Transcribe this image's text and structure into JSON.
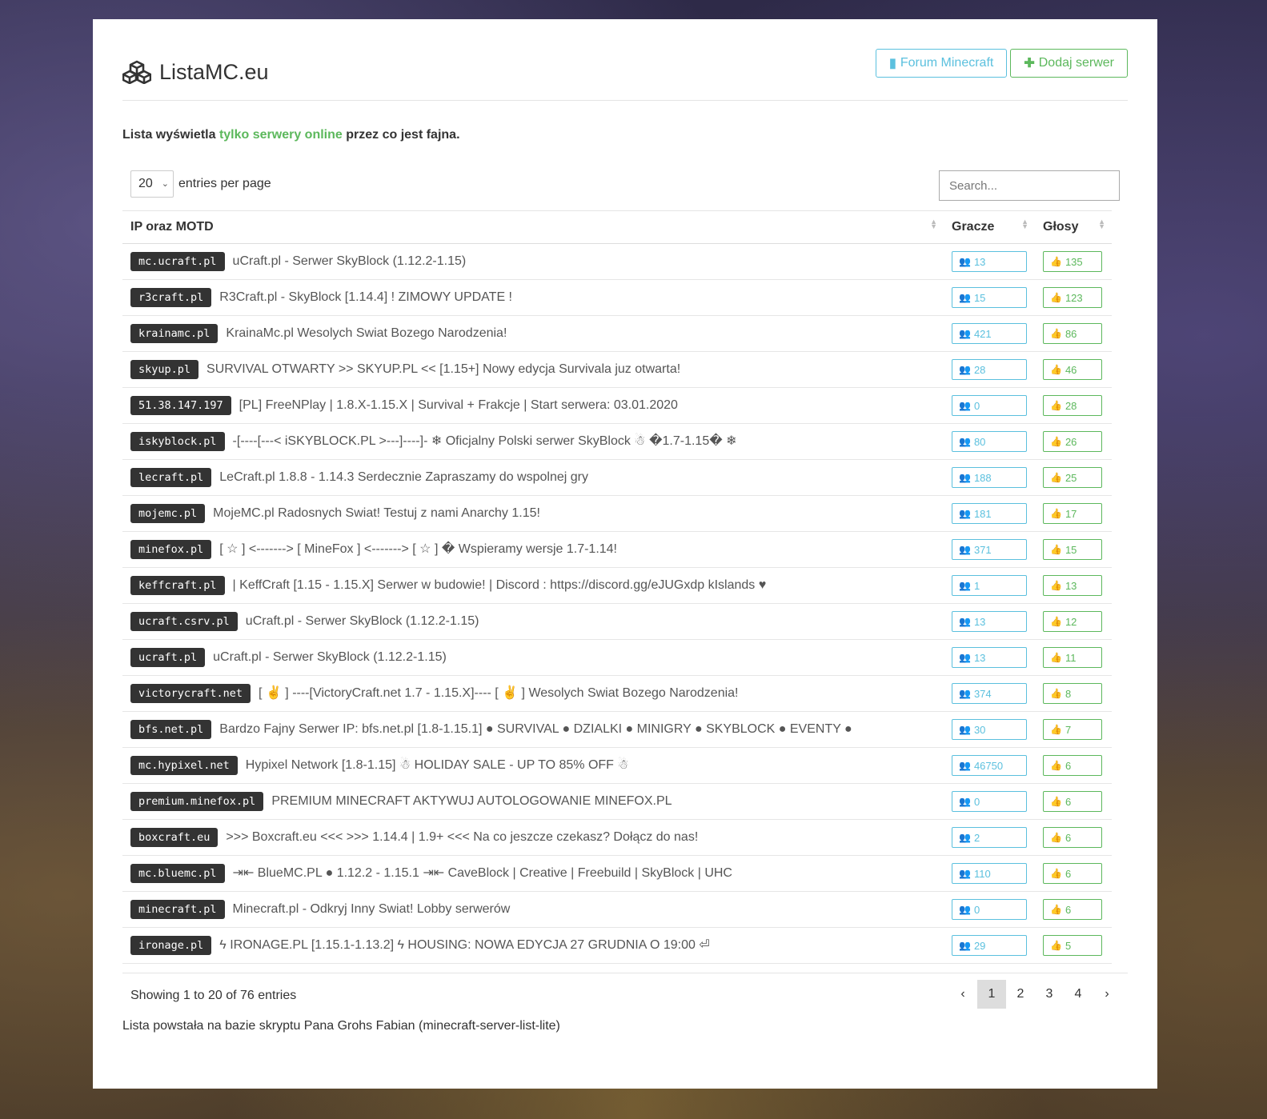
{
  "brand": {
    "title": "ListaMC.eu"
  },
  "header": {
    "forum_label": "Forum Minecraft",
    "add_label": "Dodaj serwer"
  },
  "intro": {
    "prefix": "Lista wyświetla",
    "highlight": "tylko serwery online",
    "suffix": "przez co jest fajna."
  },
  "controls": {
    "per_page": "20",
    "per_page_label": "entries per page",
    "search_placeholder": "Search..."
  },
  "table": {
    "columns": [
      "IP oraz MOTD",
      "Gracze",
      "Głosy"
    ],
    "rows": [
      {
        "ip": "mc.ucraft.pl",
        "motd": "uCraft.pl - Serwer SkyBlock (1.12.2-1.15)",
        "players": "13",
        "votes": "135"
      },
      {
        "ip": "r3craft.pl",
        "motd": "R3Craft.pl - SkyBlock [1.14.4] ! ZIMOWY UPDATE !",
        "players": "15",
        "votes": "123"
      },
      {
        "ip": "krainamc.pl",
        "motd": "KrainaMc.pl Wesolych Swiat Bozego Narodzenia!",
        "players": "421",
        "votes": "86"
      },
      {
        "ip": "skyup.pl",
        "motd": "SURVIVAL OTWARTY >> SKYUP.PL << [1.15+] Nowy edycja Survivala juz otwarta!",
        "players": "28",
        "votes": "46"
      },
      {
        "ip": "51.38.147.197",
        "motd": "[PL] FreeNPlay | 1.8.X-1.15.X | Survival + Frakcje | Start serwera: 03.01.2020",
        "players": "0",
        "votes": "28"
      },
      {
        "ip": "iskyblock.pl",
        "motd": "-[----[---< iSKYBLOCK.PL >---]----]- ❄ Oficjalny Polski serwer SkyBlock ☃ �1.7-1.15� ❄",
        "players": "80",
        "votes": "26"
      },
      {
        "ip": "lecraft.pl",
        "motd": "LeCraft.pl 1.8.8 - 1.14.3 Serdecznie Zapraszamy do wspolnej gry",
        "players": "188",
        "votes": "25"
      },
      {
        "ip": "mojemc.pl",
        "motd": "MojeMC.pl Radosnych Swiat! Testuj z nami Anarchy 1.15!",
        "players": "181",
        "votes": "17"
      },
      {
        "ip": "minefox.pl",
        "motd": "[ ☆ ] <-------> [ MineFox ] <-------> [ ☆ ] � Wspieramy wersje 1.7-1.14!",
        "players": "371",
        "votes": "15"
      },
      {
        "ip": "keffcraft.pl",
        "motd": "| KeffCraft [1.15 - 1.15.X] Serwer w budowie! | Discord : https://discord.gg/eJUGxdp kIslands ♥",
        "players": "1",
        "votes": "13"
      },
      {
        "ip": "ucraft.csrv.pl",
        "motd": "uCraft.pl - Serwer SkyBlock (1.12.2-1.15)",
        "players": "13",
        "votes": "12"
      },
      {
        "ip": "ucraft.pl",
        "motd": "uCraft.pl - Serwer SkyBlock (1.12.2-1.15)",
        "players": "13",
        "votes": "11"
      },
      {
        "ip": "victorycraft.net",
        "motd": "[ ✌ ] ----[VictoryCraft.net 1.7 - 1.15.X]---- [ ✌ ] Wesolych Swiat Bozego Narodzenia!",
        "players": "374",
        "votes": "8"
      },
      {
        "ip": "bfs.net.pl",
        "motd": "Bardzo Fajny Serwer IP: bfs.net.pl [1.8-1.15.1] ● SURVIVAL ● DZIALKI ● MINIGRY ● SKYBLOCK ● EVENTY ●",
        "players": "30",
        "votes": "7"
      },
      {
        "ip": "mc.hypixel.net",
        "motd": "Hypixel Network [1.8-1.15] ☃ HOLIDAY SALE - UP TO 85% OFF ☃",
        "players": "46750",
        "votes": "6"
      },
      {
        "ip": "premium.minefox.pl",
        "motd": "PREMIUM MINECRAFT AKTYWUJ AUTOLOGOWANIE MINEFOX.PL",
        "players": "0",
        "votes": "6"
      },
      {
        "ip": "boxcraft.eu",
        "motd": ">>> Boxcraft.eu <<< >>> 1.14.4 | 1.9+ <<< Na co jeszcze czekasz? Dołącz do nas!",
        "players": "2",
        "votes": "6"
      },
      {
        "ip": "mc.bluemc.pl",
        "motd": "⇥⇤ BlueMC.PL ● 1.12.2 - 1.15.1 ⇥⇤ CaveBlock | Creative | Freebuild | SkyBlock | UHC",
        "players": "110",
        "votes": "6"
      },
      {
        "ip": "minecraft.pl",
        "motd": "Minecraft.pl - Odkryj Inny Swiat! Lobby serwerów",
        "players": "0",
        "votes": "6"
      },
      {
        "ip": "ironage.pl",
        "motd": "ϟ IRONAGE.PL [1.15.1-1.13.2] ϟ HOUSING: NOWA EDYCJA 27 GRUDNIA O 19:00 ⏎",
        "players": "29",
        "votes": "5"
      }
    ]
  },
  "footer": {
    "showing": "Showing 1 to 20 of 76 entries",
    "pages": [
      "‹",
      "1",
      "2",
      "3",
      "4",
      "›"
    ],
    "active_page": "1",
    "credits": "Lista powstała na bazie skryptu Pana Grohs Fabian (minecraft-server-list-lite)"
  },
  "colors": {
    "info": "#5bc0de",
    "success": "#5cb85c",
    "ip_badge": "#333333"
  },
  "icons": {
    "brand": "cubes-icon",
    "forum": "book-icon",
    "add": "plus-icon",
    "players": "users-icon",
    "votes": "thumbs-up-icon"
  }
}
